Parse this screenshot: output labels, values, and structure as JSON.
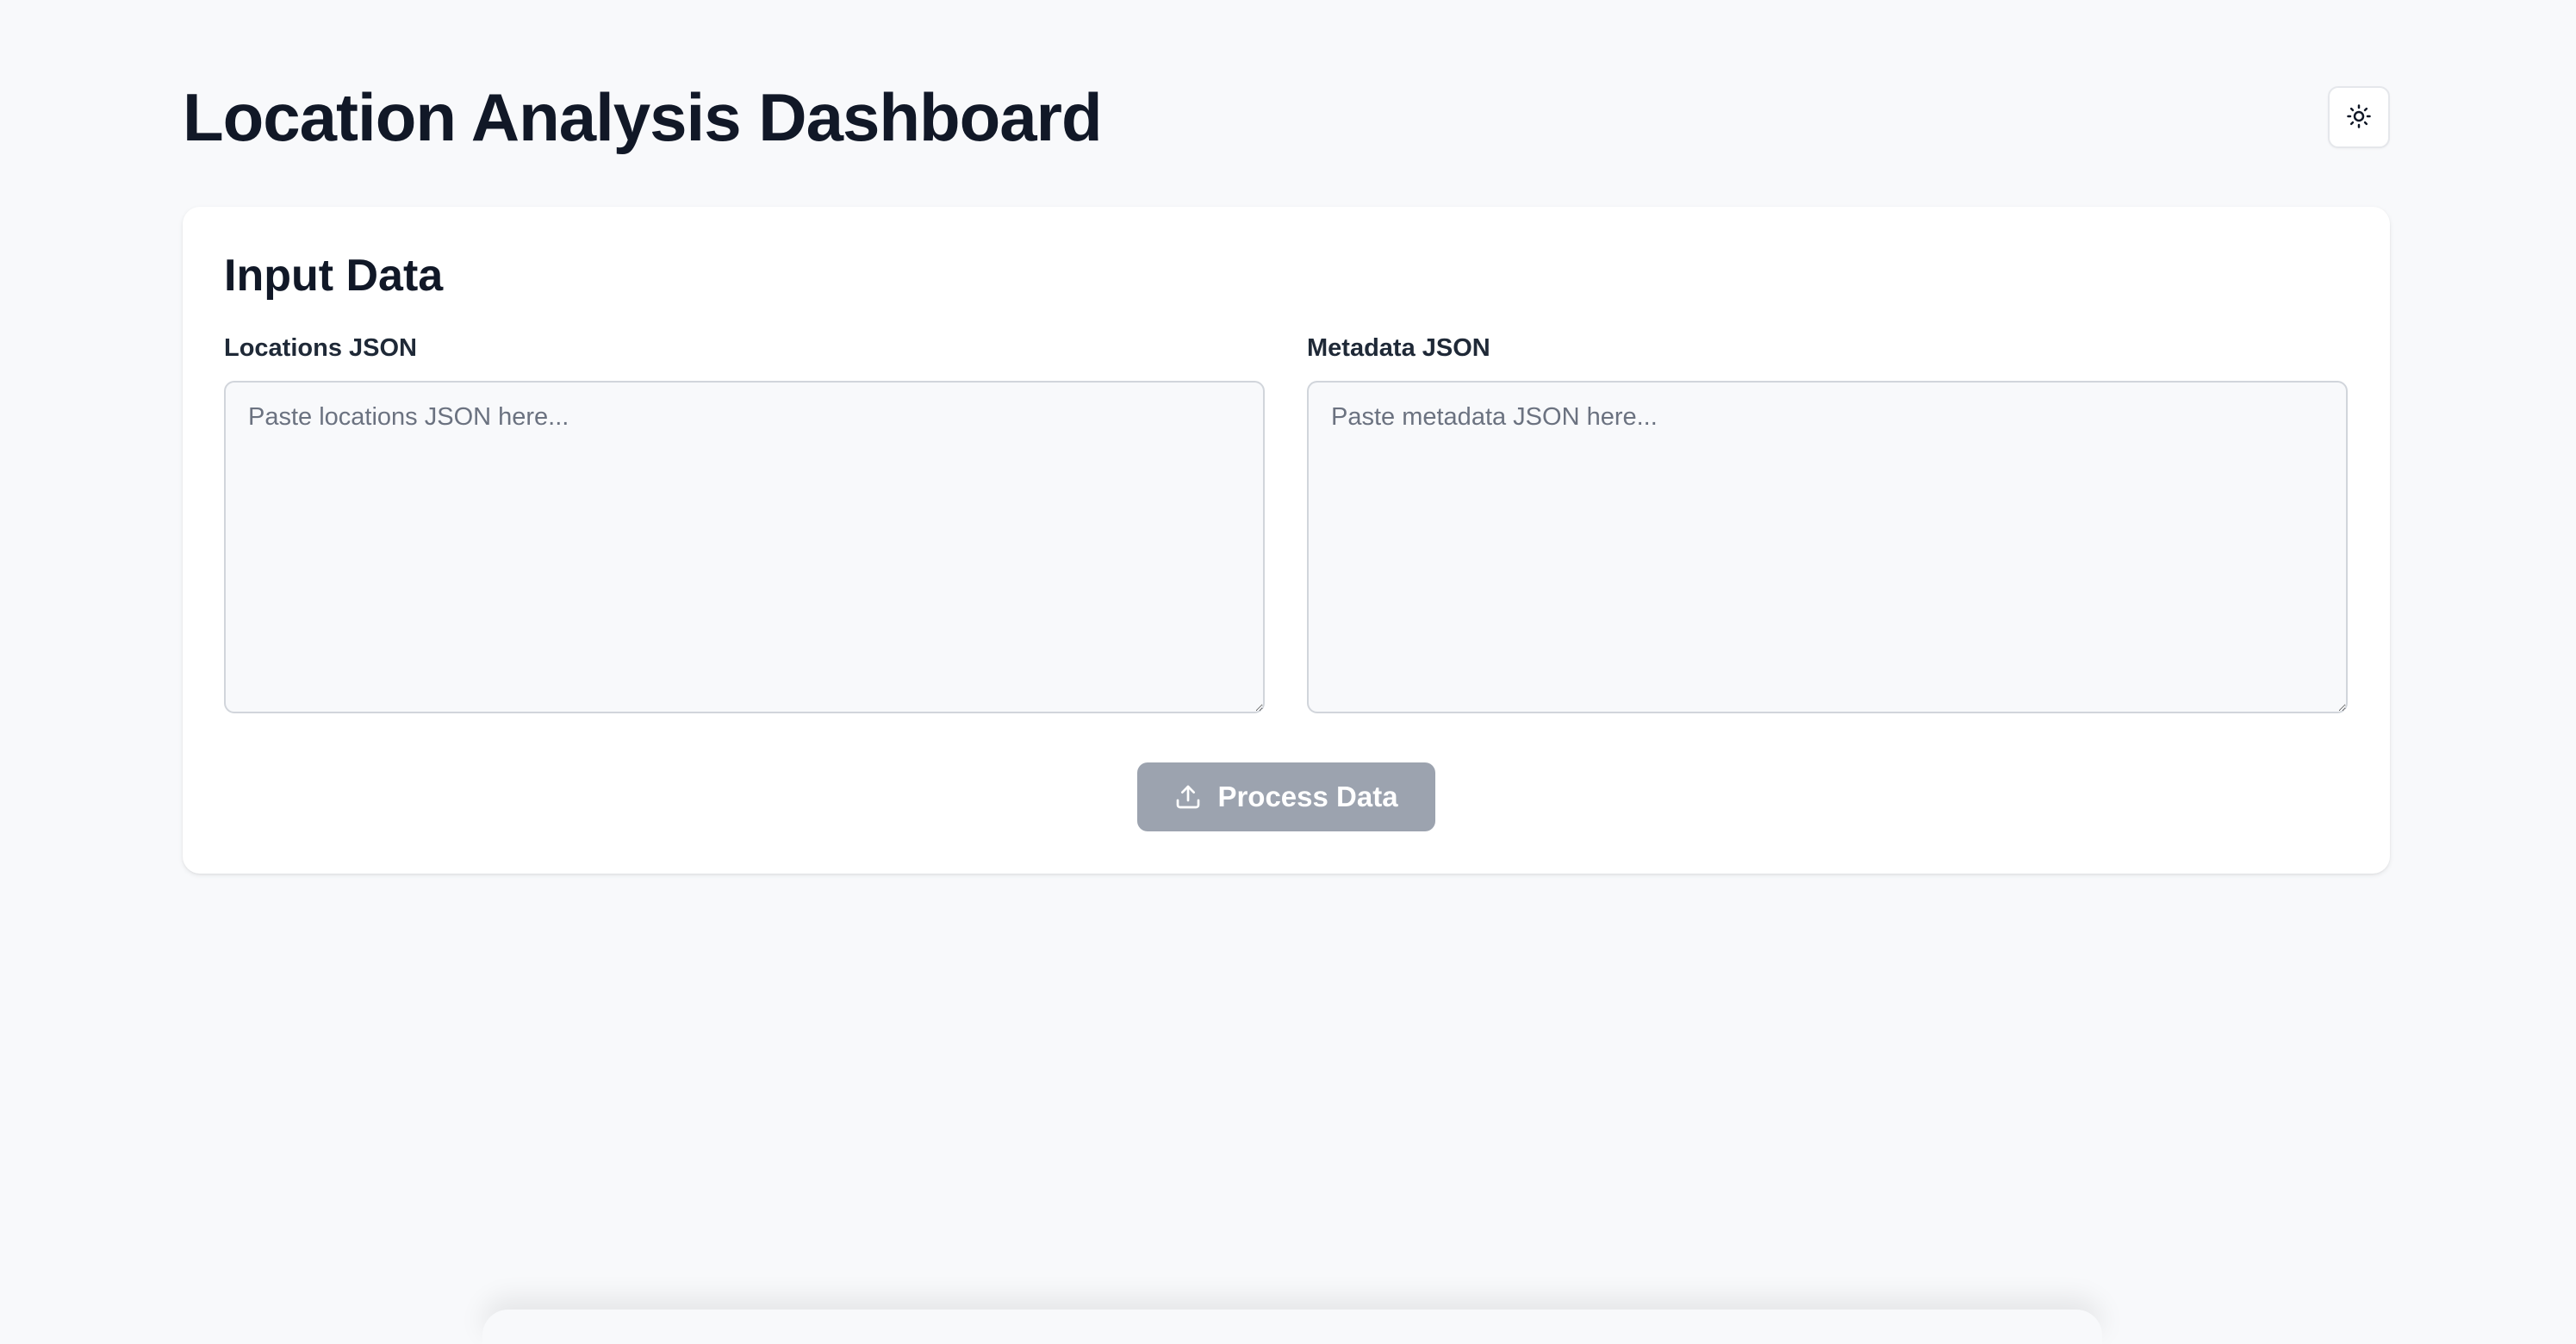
{
  "header": {
    "title": "Location Analysis Dashboard",
    "theme_toggle_icon": "sun-icon"
  },
  "input_card": {
    "title": "Input Data",
    "locations": {
      "label": "Locations JSON",
      "value": "",
      "placeholder": "Paste locations JSON here..."
    },
    "metadata": {
      "label": "Metadata JSON",
      "value": "",
      "placeholder": "Paste metadata JSON here..."
    },
    "process_button": {
      "label": "Process Data",
      "icon": "upload-icon",
      "disabled": true
    }
  },
  "colors": {
    "background": "#f8f9fb",
    "card": "#ffffff",
    "text": "#111827",
    "button_disabled": "#9ca3af"
  }
}
